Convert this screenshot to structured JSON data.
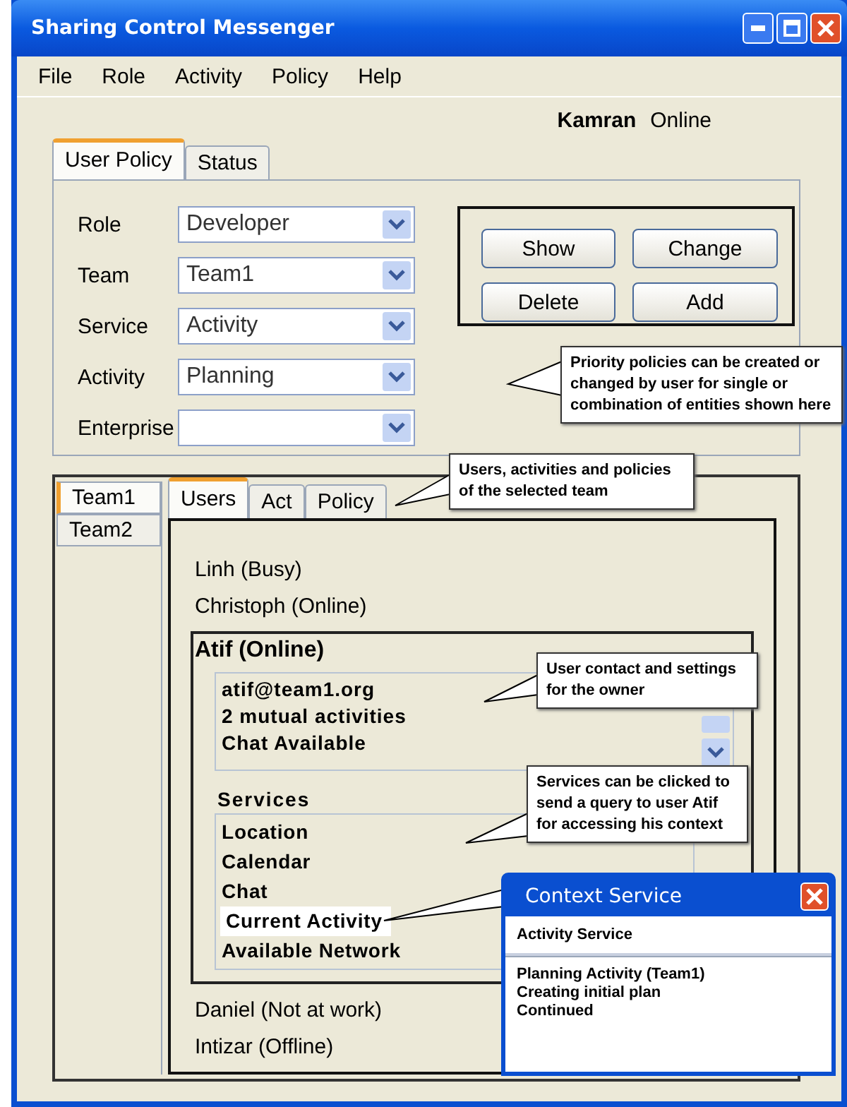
{
  "window": {
    "title": "Sharing Control Messenger"
  },
  "menu": [
    "File",
    "Role",
    "Activity",
    "Policy",
    "Help"
  ],
  "user": {
    "name": "Kamran",
    "status": "Online"
  },
  "policy_tabs": [
    {
      "label": "User Policy",
      "selected": true
    },
    {
      "label": "Status",
      "selected": false
    }
  ],
  "policy_fields": [
    {
      "label": "Role",
      "value": "Developer"
    },
    {
      "label": "Team",
      "value": "Team1"
    },
    {
      "label": "Service",
      "value": "Activity"
    },
    {
      "label": "Activity",
      "value": "Planning"
    },
    {
      "label": "Enterprise"
    }
  ],
  "policy_buttons": [
    "Show",
    "Change",
    "Delete",
    "Add"
  ],
  "team_tabs": [
    {
      "label": "Team1",
      "selected": true
    },
    {
      "label": "Team2",
      "selected": false
    }
  ],
  "view_tabs": [
    {
      "label": "Users",
      "selected": true
    },
    {
      "label": "Act",
      "selected": false
    },
    {
      "label": "Policy",
      "selected": false
    }
  ],
  "users": [
    {
      "name": "Linh (Busy)",
      "expanded": false
    },
    {
      "name": "Christoph (Online)",
      "expanded": false
    },
    {
      "name": "Atif (Online)",
      "expanded": true,
      "details": [
        "atif@team1.org",
        "2 mutual activities",
        "Chat Available"
      ],
      "services_heading": "Services",
      "services": [
        {
          "label": "Location",
          "selected": false
        },
        {
          "label": "Calendar",
          "selected": false
        },
        {
          "label": "Chat",
          "selected": false
        },
        {
          "label": "Current Activity",
          "selected": true
        },
        {
          "label": "Available Network",
          "selected": false
        }
      ]
    },
    {
      "name": "Daniel (Not at work)",
      "expanded": false
    },
    {
      "name": "Intizar (Offline)",
      "expanded": false
    }
  ],
  "popup": {
    "title": "Context Service",
    "heading": "Activity Service",
    "lines": [
      "Planning Activity (Team1)",
      "Creating initial plan",
      "Continued"
    ]
  },
  "callouts": [
    "Priority policies can be created or changed by user for single or combination of entities shown here",
    "Users, activities and policies of the selected team",
    "User contact and settings for the owner",
    "Services can be clicked to send a query to user Atif for accessing his context"
  ]
}
